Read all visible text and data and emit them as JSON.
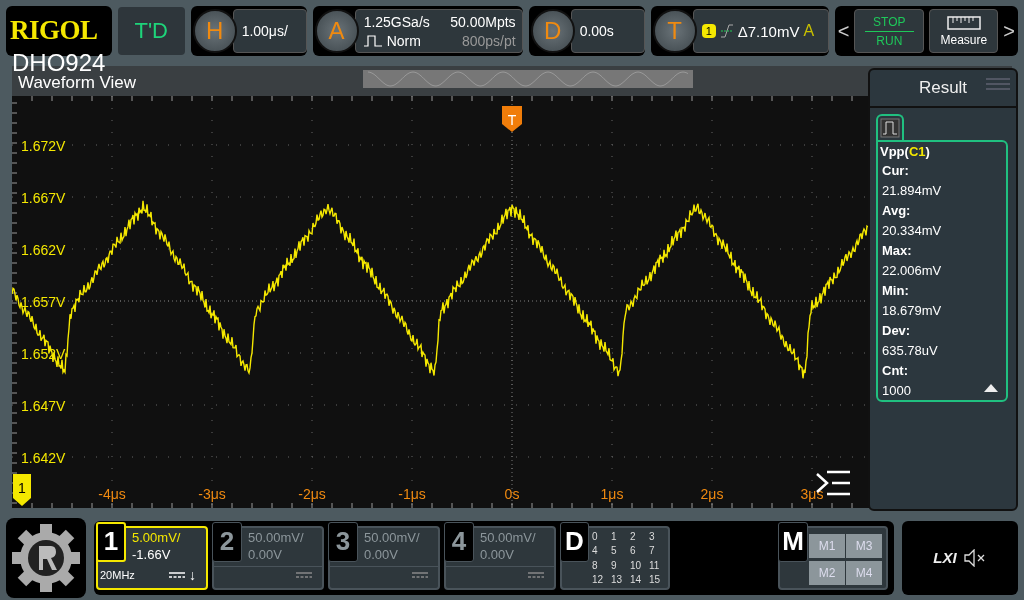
{
  "brand": {
    "logo": "RIGOL",
    "model": "DHO924"
  },
  "top_bar": {
    "td": "T'D",
    "horizontal": {
      "label": "H",
      "value": "1.00μs/"
    },
    "acquire": {
      "label": "A",
      "sample_rate": "1.25GSa/s",
      "mode": "Norm",
      "memory": "50.00Mpts",
      "resolution": "800ps/pt"
    },
    "delay": {
      "label": "D",
      "value": "0.00s"
    },
    "trigger": {
      "label": "T",
      "source": "1",
      "level": "Δ7.10mV",
      "mode": "A"
    },
    "prev_arrow": "<",
    "run_stop": {
      "stop": "STOP",
      "run": "RUN"
    },
    "measure_button": "Measure",
    "next_arrow": ">"
  },
  "waveform_view": {
    "title": "Waveform View",
    "trigger_marker": "T",
    "channel_marker": "1",
    "y_labels": [
      "1.672V",
      "1.667V",
      "1.662V",
      "1.657V",
      "1.652V",
      "1.647V",
      "1.642V"
    ],
    "x_labels": [
      "-4μs",
      "-3μs",
      "-2μs",
      "-1μs",
      "0s",
      "1μs",
      "2μs",
      "3μs"
    ]
  },
  "result_panel": {
    "title": "Result",
    "measurement": {
      "name": "Vpp(",
      "source": "C1",
      "close": ")",
      "items": [
        {
          "label": "Cur:",
          "value": "21.894mV"
        },
        {
          "label": "Avg:",
          "value": "20.334mV"
        },
        {
          "label": "Max:",
          "value": "22.006mV"
        },
        {
          "label": "Min:",
          "value": "18.679mV"
        },
        {
          "label": "Dev:",
          "value": "635.78uV"
        },
        {
          "label": "Cnt:",
          "value": "1000"
        }
      ]
    }
  },
  "channels": [
    {
      "number": "1",
      "scale": "5.00mV/",
      "offset": "-1.66V",
      "bandwidth": "20MHz",
      "arrow": "↓",
      "active": true
    },
    {
      "number": "2",
      "scale": "50.00mV/",
      "offset": "0.00V",
      "active": false
    },
    {
      "number": "3",
      "scale": "50.00mV/",
      "offset": "0.00V",
      "active": false
    },
    {
      "number": "4",
      "scale": "50.00mV/",
      "offset": "0.00V",
      "active": false
    }
  ],
  "digital": {
    "label": "D",
    "bits": [
      "0",
      "1",
      "2",
      "3",
      "4",
      "5",
      "6",
      "7",
      "8",
      "9",
      "10",
      "11",
      "12",
      "13",
      "14",
      "15"
    ]
  },
  "math": {
    "label": "M",
    "items": [
      "M1",
      "M3",
      "M2",
      "M4"
    ]
  },
  "status": {
    "lxi": "LXI"
  }
}
